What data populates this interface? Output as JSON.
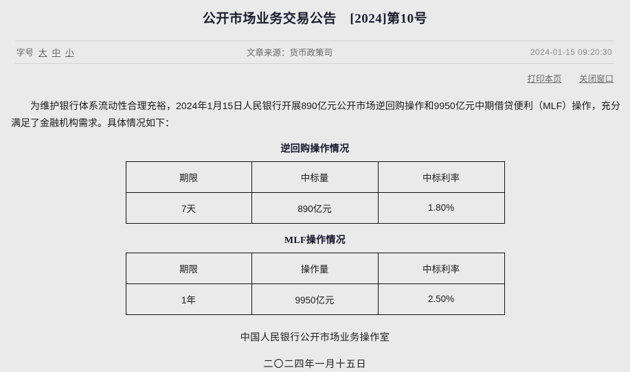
{
  "document": {
    "title": "公开市场业务交易公告　[2024]第10号"
  },
  "meta": {
    "fontsize_label": "字号",
    "fontsize_large": "大",
    "fontsize_medium": "中",
    "fontsize_small": "小",
    "source": "文章来源：货币政策司",
    "timestamp": "2024-01-15 09:20:30"
  },
  "actions": {
    "print": "打印本页",
    "close": "关闭窗口"
  },
  "body": {
    "paragraph": "为维护银行体系流动性合理充裕，2024年1月15日人民银行开展890亿元公开市场逆回购操作和9950亿元中期借贷便利（MLF）操作，充分满足了金融机构需求。具体情况如下："
  },
  "sections": [
    {
      "heading": "逆回购操作情况",
      "table": {
        "headers": [
          "期限",
          "中标量",
          "中标利率"
        ],
        "rows": [
          [
            "7天",
            "890亿元",
            "1.80%"
          ]
        ]
      }
    },
    {
      "heading": "MLF操作情况",
      "table": {
        "headers": [
          "期限",
          "操作量",
          "中标利率"
        ],
        "rows": [
          [
            "1年",
            "9950亿元",
            "2.50%"
          ]
        ]
      }
    }
  ],
  "signature": {
    "organization": "中国人民银行公开市场业务操作室",
    "date": "二〇二四年一月十五日"
  },
  "colors": {
    "page_background": "#eaeaea",
    "title_text": "#1b1b2f",
    "body_text": "#1a1a1a",
    "meta_text": "#666666",
    "timestamp_text": "#8a8a8a",
    "rule": "#d2d2d2",
    "table_border": "#111111"
  }
}
